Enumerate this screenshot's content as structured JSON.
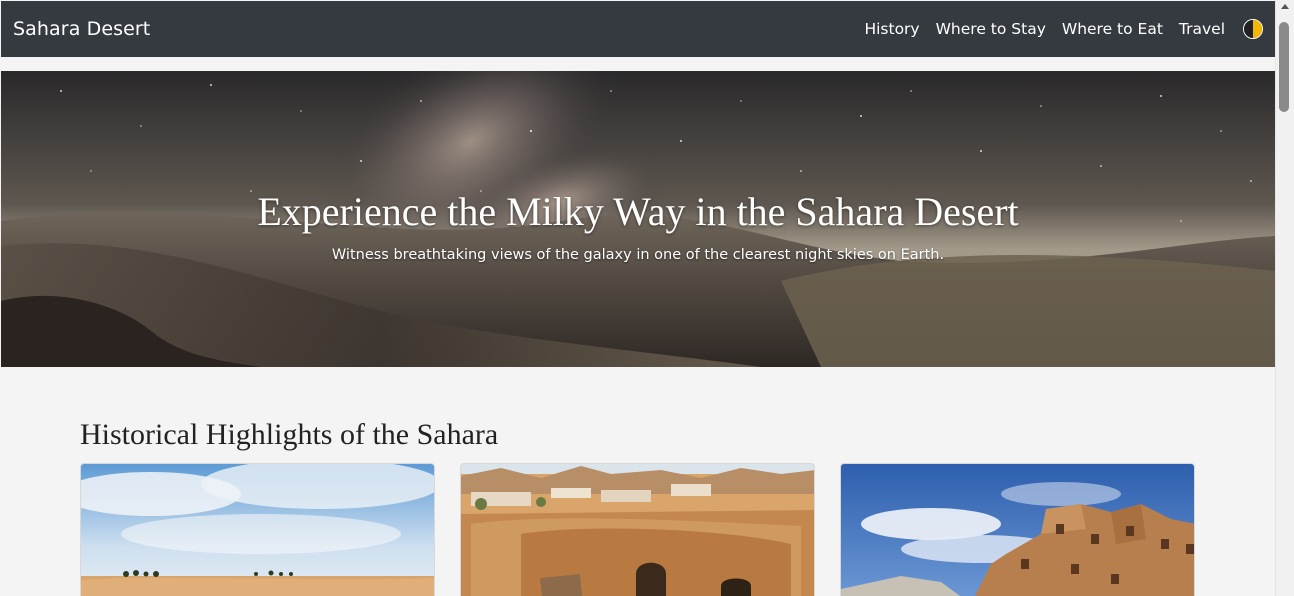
{
  "navbar": {
    "brand": "Sahara Desert",
    "links": [
      {
        "label": "History"
      },
      {
        "label": "Where to Stay"
      },
      {
        "label": "Where to Eat"
      },
      {
        "label": "Travel"
      }
    ],
    "theme_toggle_icon": "half-moon-theme-icon"
  },
  "hero": {
    "title": "Experience the Milky Way in the Sahara Desert",
    "subtitle": "Witness breathtaking views of the galaxy in one of the clearest night skies on Earth."
  },
  "history": {
    "title": "Historical Highlights of the Sahara",
    "cards": [
      {
        "image": "sahara-dunes-oasis-photo"
      },
      {
        "image": "troglodyte-cave-dwelling-photo"
      },
      {
        "image": "ksar-granary-ruins-photo"
      }
    ]
  },
  "colors": {
    "navbar_bg": "#343a40",
    "page_bg": "#f4f4f4",
    "toggle_accent": "#f5b800"
  }
}
